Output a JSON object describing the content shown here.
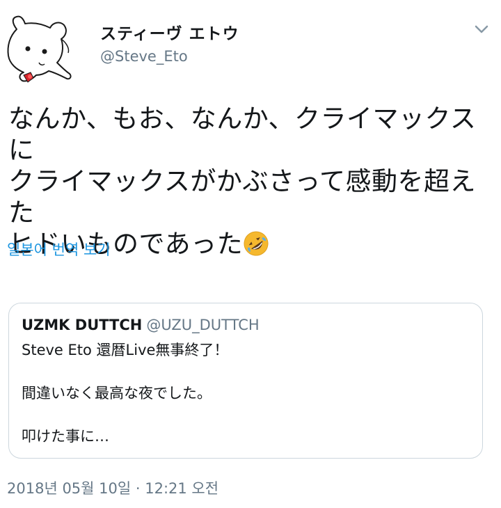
{
  "author": {
    "display_name": "スティーヴ エトウ",
    "handle": "@Steve_Eto"
  },
  "tweet": {
    "text": "なんか、もお、なんか、クライマックスに\nクライマックスがかぶさって感動を超えた\nヒドいものであった",
    "emoji": "rolling-on-floor-laughing-emoji"
  },
  "translate_label": "일본어 번역 보기",
  "quote": {
    "name": "UZMK DUTTCH",
    "handle": "@UZU_DUTTCH",
    "lines": [
      "Steve Eto 還暦Live無事終了！",
      "間違いなく最高な夜でした。",
      "叩けた事に…"
    ]
  },
  "timestamp": "2018년 05월 10일 · 12:21 오전",
  "colors": {
    "link": "#1b95e0",
    "secondary_text": "#657786",
    "border": "#ccd6dd",
    "emoji_face": "#f5b82e"
  }
}
